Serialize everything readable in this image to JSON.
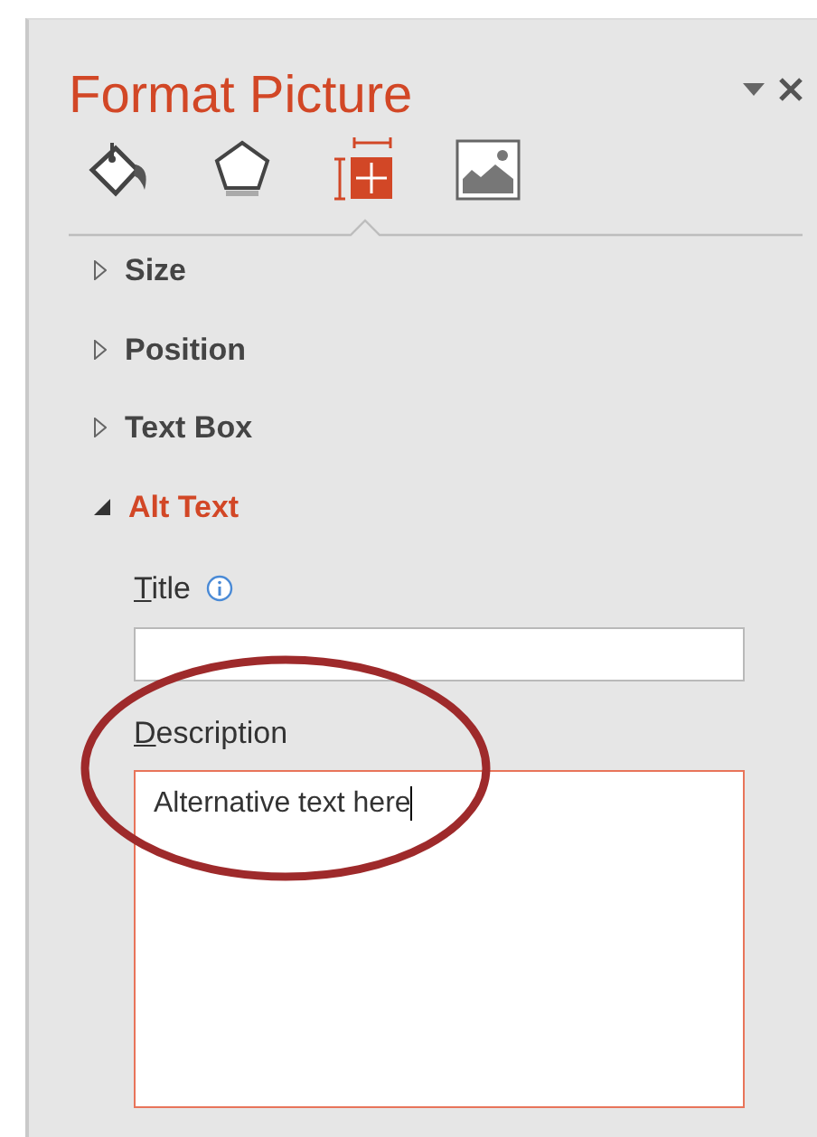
{
  "pane": {
    "title": "Format Picture"
  },
  "tabs": [
    {
      "selected": false
    },
    {
      "selected": false
    },
    {
      "selected": true
    },
    {
      "selected": false
    }
  ],
  "sections": [
    {
      "label": "Size",
      "expanded": false
    },
    {
      "label": "Position",
      "expanded": false
    },
    {
      "label": "Text Box",
      "expanded": false
    },
    {
      "label": "Alt Text",
      "expanded": true
    }
  ],
  "alt_text": {
    "title_label": "Title",
    "description_label": "Description",
    "description_value": "Alternative text here",
    "description_focused": true
  },
  "annotation": {
    "kind": "ellipse"
  }
}
